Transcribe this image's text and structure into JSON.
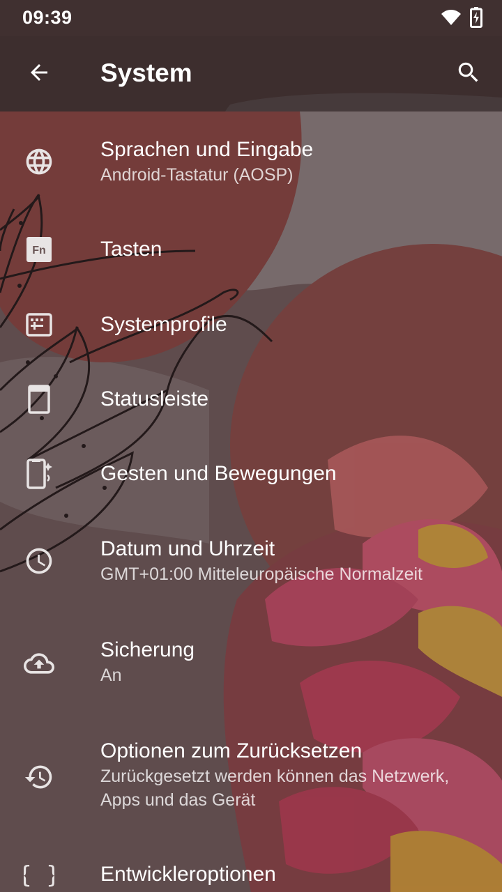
{
  "status_bar": {
    "time": "09:39",
    "icons": [
      "wifi-icon",
      "battery-charging-icon"
    ]
  },
  "toolbar": {
    "back_icon": "arrow-back-icon",
    "title": "System",
    "search_icon": "search-icon"
  },
  "settings": [
    {
      "icon": "globe-icon",
      "title": "Sprachen und Eingabe",
      "summary": "Android-Tastatur (AOSP)"
    },
    {
      "icon": "fn-key-icon",
      "title": "Tasten",
      "summary": ""
    },
    {
      "icon": "system-profiles-icon",
      "title": "Systemprofile",
      "summary": ""
    },
    {
      "icon": "status-bar-icon",
      "title": "Statusleiste",
      "summary": ""
    },
    {
      "icon": "gestures-phone-icon",
      "title": "Gesten und Bewegungen",
      "summary": ""
    },
    {
      "icon": "clock-icon",
      "title": "Datum und Uhrzeit",
      "summary": "GMT+01:00 Mitteleuropäische Normalzeit"
    },
    {
      "icon": "cloud-upload-icon",
      "title": "Sicherung",
      "summary": "An"
    },
    {
      "icon": "reset-history-icon",
      "title": "Optionen zum Zurücksetzen",
      "summary": "Zurückgesetzt werden können das Netzwerk, Apps und das Gerät"
    },
    {
      "icon": "curly-braces-icon",
      "title": "Entwickleroptionen",
      "summary": ""
    }
  ],
  "colors": {
    "wallpaper_base": "#6a5555",
    "wallpaper_blob": "#8a4540",
    "flower_pink": "#d94a6a",
    "flower_yellow": "#e0a830",
    "text_primary": "#ffffff",
    "text_secondary": "rgba(255,255,255,0.78)"
  }
}
